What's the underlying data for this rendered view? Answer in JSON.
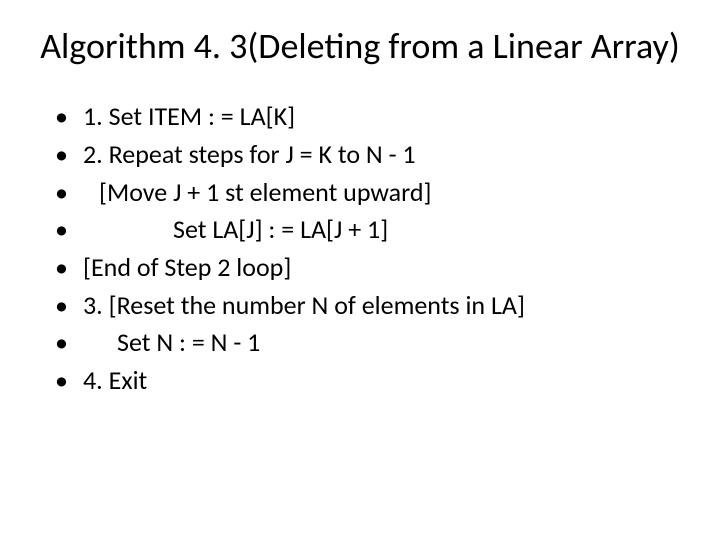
{
  "title": "Algorithm 4. 3(Deleting from a Linear Array)",
  "steps": [
    "1. Set ITEM : = LA[K]",
    "2. Repeat steps for J = K to N - 1",
    "   [Move J + 1 st element upward]",
    "             Set LA[J] : = LA[J + 1]",
    "[End of Step 2 loop]",
    "3. [Reset the number N of elements in LA]",
    "     Set N : = N - 1",
    "4. Exit"
  ]
}
